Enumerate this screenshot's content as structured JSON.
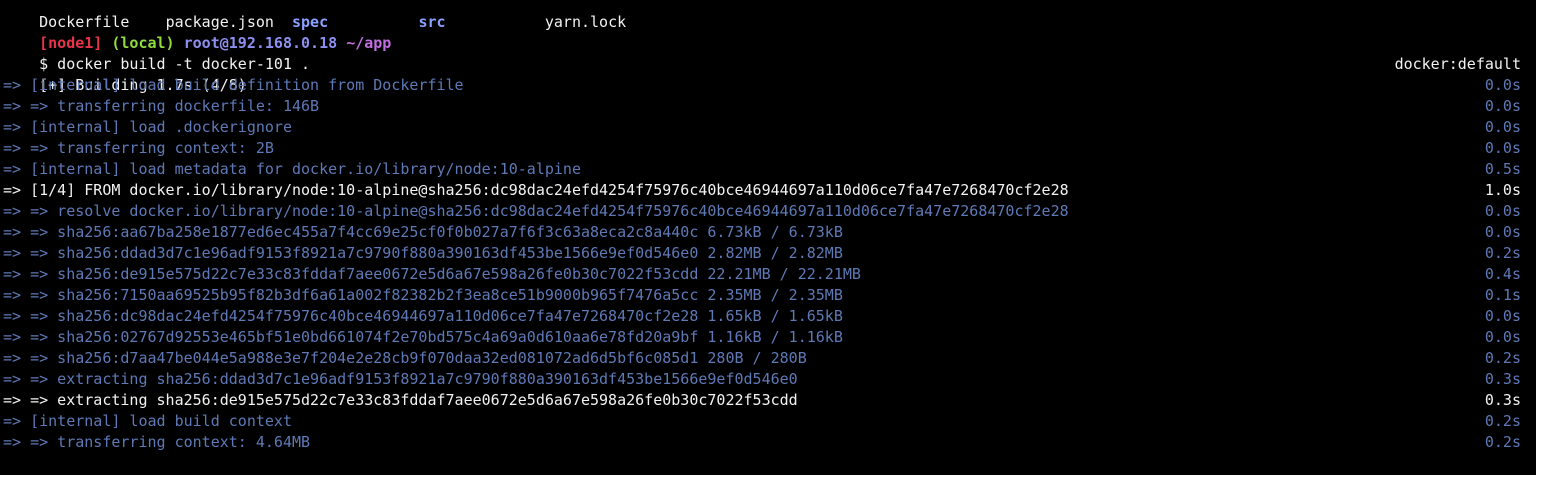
{
  "colors": {
    "background": "#000000",
    "dim_text": "#5e79b6",
    "bright_text": "#f2f2f2",
    "prompt_node": "#e8344b",
    "prompt_local": "#8fdc3c",
    "prompt_host": "#8d90f0",
    "prompt_path": "#c06ee0"
  },
  "ls_row": [
    {
      "text": "Dockerfile",
      "style": "white"
    },
    {
      "text": "package.json",
      "style": "white"
    },
    {
      "text": "spec",
      "style": "ls-blue"
    },
    {
      "text": "src",
      "style": "ls-blue"
    },
    {
      "text": "yarn.lock",
      "style": "white"
    }
  ],
  "prompt": {
    "node": "[node1]",
    "env": "(local)",
    "host": "root@192.168.0.18",
    "path": "~/app"
  },
  "command": "$ docker build -t docker-101 .",
  "build_header": {
    "status": "[+] Building 1.7s (4/8)",
    "builder": "docker:default"
  },
  "steps": [
    {
      "text": "=> [internal] load build definition from Dockerfile",
      "time": "0.0s",
      "bright": false
    },
    {
      "text": "=> => transferring dockerfile: 146B",
      "time": "0.0s",
      "bright": false
    },
    {
      "text": "=> [internal] load .dockerignore",
      "time": "0.0s",
      "bright": false
    },
    {
      "text": "=> => transferring context: 2B",
      "time": "0.0s",
      "bright": false
    },
    {
      "text": "=> [internal] load metadata for docker.io/library/node:10-alpine",
      "time": "0.5s",
      "bright": false
    },
    {
      "text": "=> [1/4] FROM docker.io/library/node:10-alpine@sha256:dc98dac24efd4254f75976c40bce46944697a110d06ce7fa47e7268470cf2e28",
      "time": "1.0s",
      "bright": true
    },
    {
      "text": "=> => resolve docker.io/library/node:10-alpine@sha256:dc98dac24efd4254f75976c40bce46944697a110d06ce7fa47e7268470cf2e28",
      "time": "0.0s",
      "bright": false
    },
    {
      "text": "=> => sha256:aa67ba258e1877ed6ec455a7f4cc69e25cf0f0b027a7f6f3c63a8eca2c8a440c 6.73kB / 6.73kB",
      "time": "0.0s",
      "bright": false
    },
    {
      "text": "=> => sha256:ddad3d7c1e96adf9153f8921a7c9790f880a390163df453be1566e9ef0d546e0 2.82MB / 2.82MB",
      "time": "0.2s",
      "bright": false
    },
    {
      "text": "=> => sha256:de915e575d22c7e33c83fddaf7aee0672e5d6a67e598a26fe0b30c7022f53cdd 22.21MB / 22.21MB",
      "time": "0.4s",
      "bright": false
    },
    {
      "text": "=> => sha256:7150aa69525b95f82b3df6a61a002f82382b2f3ea8ce51b9000b965f7476a5cc 2.35MB / 2.35MB",
      "time": "0.1s",
      "bright": false
    },
    {
      "text": "=> => sha256:dc98dac24efd4254f75976c40bce46944697a110d06ce7fa47e7268470cf2e28 1.65kB / 1.65kB",
      "time": "0.0s",
      "bright": false
    },
    {
      "text": "=> => sha256:02767d92553e465bf51e0bd661074f2e70bd575c4a69a0d610aa6e78fd20a9bf 1.16kB / 1.16kB",
      "time": "0.0s",
      "bright": false
    },
    {
      "text": "=> => sha256:d7aa47be044e5a988e3e7f204e2e28cb9f070daa32ed081072ad6d5bf6c085d1 280B / 280B",
      "time": "0.2s",
      "bright": false
    },
    {
      "text": "=> => extracting sha256:ddad3d7c1e96adf9153f8921a7c9790f880a390163df453be1566e9ef0d546e0",
      "time": "0.3s",
      "bright": false
    },
    {
      "text": "=> => extracting sha256:de915e575d22c7e33c83fddaf7aee0672e5d6a67e598a26fe0b30c7022f53cdd",
      "time": "0.3s",
      "bright": true
    },
    {
      "text": "=> [internal] load build context",
      "time": "0.2s",
      "bright": false
    },
    {
      "text": "=> => transferring context: 4.64MB",
      "time": "0.2s",
      "bright": false
    }
  ]
}
